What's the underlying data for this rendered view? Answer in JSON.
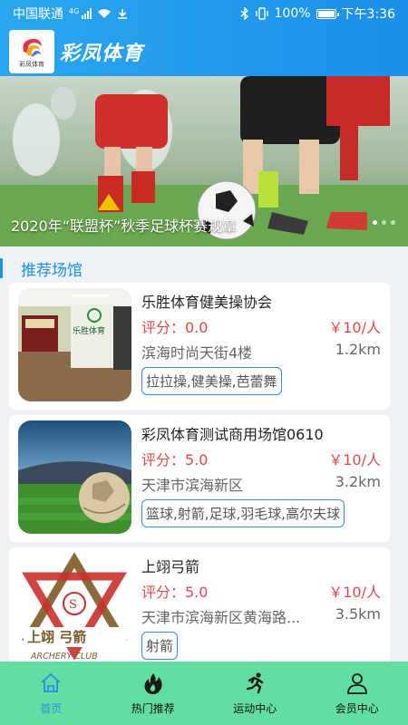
{
  "status_bar": {
    "carrier": "中国联通",
    "network": "4G",
    "battery": "100%",
    "time": "下午3:36"
  },
  "app": {
    "logo_text": "彩凤体育",
    "title": "彩凤体育"
  },
  "banner": {
    "caption": "2020年“联盟杯”秋季足球杯赛规章",
    "slide_count": 3,
    "active_slide": 1
  },
  "section_title": "推荐场馆",
  "venues": [
    {
      "name": "乐胜体育健美操协会",
      "score_label": "评分：0.0",
      "price": "￥10/人",
      "address": "滨海时尚天街4楼",
      "distance": "1.2km",
      "tags": "拉拉操,健美操,芭蕾舞",
      "image": "dance-studio-photo",
      "image_sign": "乐胜体育"
    },
    {
      "name": "彩凤体育测试商用场馆0610",
      "score_label": "评分：5.0",
      "price": "￥10/人",
      "address": "天津市滨海新区",
      "distance": "3.2km",
      "tags": "篮球,射箭,足球,羽毛球,高尔夫球",
      "image": "stadium-football-photo"
    },
    {
      "name": "上翊弓箭",
      "score_label": "评分：5.0",
      "price": "￥10/人",
      "address": "天津市滨海新区黄海路...",
      "distance": "3.5km",
      "tags": "射箭",
      "image": "archery-club-logo",
      "image_text": "上翊 弓箭",
      "image_subtext": "ARCHERY CLUB"
    }
  ],
  "nav": [
    {
      "label": "首页",
      "icon": "home-icon",
      "active": true
    },
    {
      "label": "热门推荐",
      "icon": "flame-icon",
      "active": false
    },
    {
      "label": "运动中心",
      "icon": "runner-icon",
      "active": false
    },
    {
      "label": "会员中心",
      "icon": "user-icon",
      "active": false
    }
  ],
  "colors": {
    "header": "#1a90ea",
    "accent": "#1a8fe8",
    "price": "#e24a4a",
    "nav_bg": "#61dea0",
    "tag_border": "#3a8bd6"
  }
}
